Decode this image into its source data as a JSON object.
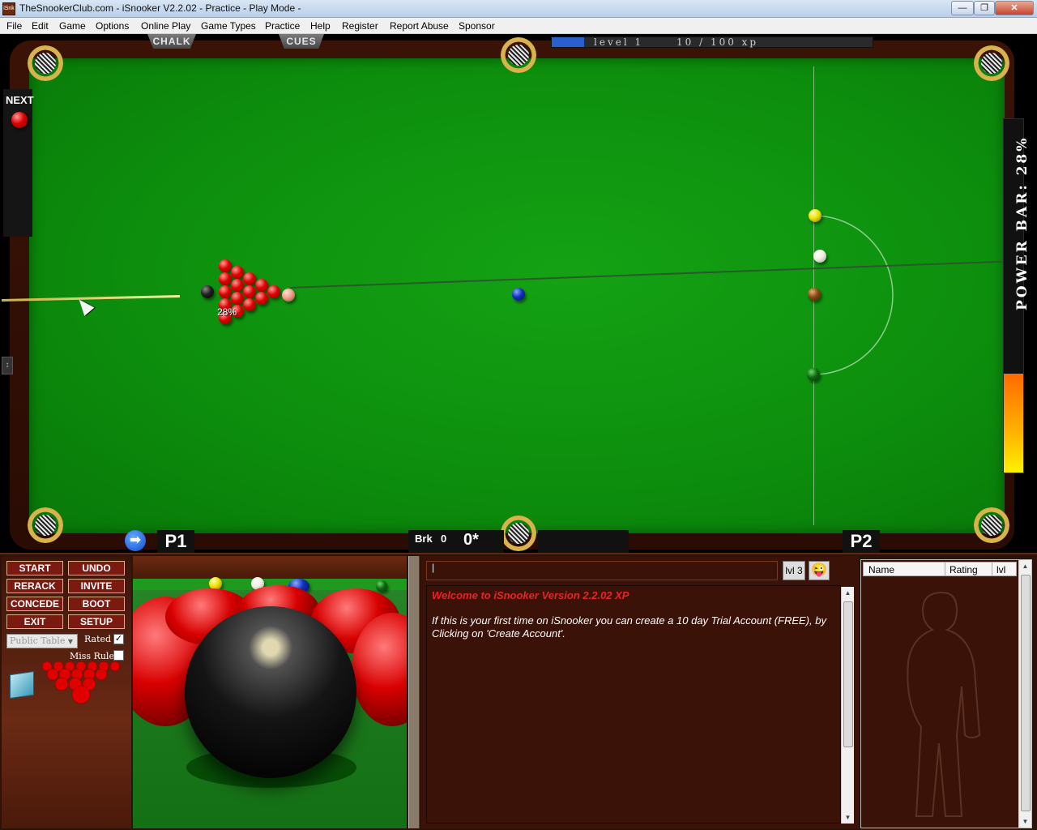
{
  "window": {
    "icon_text": "iSnk",
    "title": "TheSnookerClub.com - iSnooker V2.2.02 -  Practice - Play Mode -",
    "minimize": "—",
    "maximize": "❐",
    "close": "✕"
  },
  "menu": [
    "File",
    "Edit",
    "Game",
    "Options",
    "Online Play",
    "Game Types",
    "Practice",
    "Help",
    "Register",
    "Report Abuse",
    "Sponsor"
  ],
  "top_tabs": {
    "chalk": "CHALK",
    "cues": "CUES"
  },
  "xp": {
    "level": "level 1",
    "text": "10 / 100 xp",
    "current": 10,
    "max": 100
  },
  "next": {
    "label": "NEXT",
    "ball_color": "red"
  },
  "aim": {
    "percent_label": "28%"
  },
  "power_bar": {
    "label": "POWER BAR: 28%",
    "percent": 28
  },
  "score": {
    "p1": "P1",
    "p2": "P2",
    "brk_label": "Brk",
    "brk_value": "0",
    "score_value": "0*"
  },
  "controls": {
    "start": "START",
    "undo": "UNDO",
    "rerack": "RERACK",
    "invite": "INVITE",
    "concede": "CONCEDE",
    "boot": "BOOT",
    "exit": "EXIT",
    "setup": "SETUP",
    "table_select": "Public Table",
    "rated_label": "Rated",
    "rated_checked": true,
    "miss_rule_label": "Miss Rule",
    "miss_rule_checked": false
  },
  "chat": {
    "input_value": "|",
    "lvl_badge": "lvl 3",
    "welcome": "Welcome to iSnooker Version 2.2.02 XP",
    "info": "If this is your first time on iSnooker you can create a 10 day Trial Account (FREE), by Clicking on 'Create Account'."
  },
  "players_list": {
    "col_name": "Name",
    "col_rating": "Rating",
    "col_lvl": "lvl"
  },
  "icons": {
    "next_arrow": "➡",
    "emoji": "😜",
    "handle": "↕"
  },
  "colors": {
    "cloth": "#0d8f0d",
    "rail": "#3b1206",
    "button": "#7a1a10",
    "welcome": "#ee2222"
  }
}
